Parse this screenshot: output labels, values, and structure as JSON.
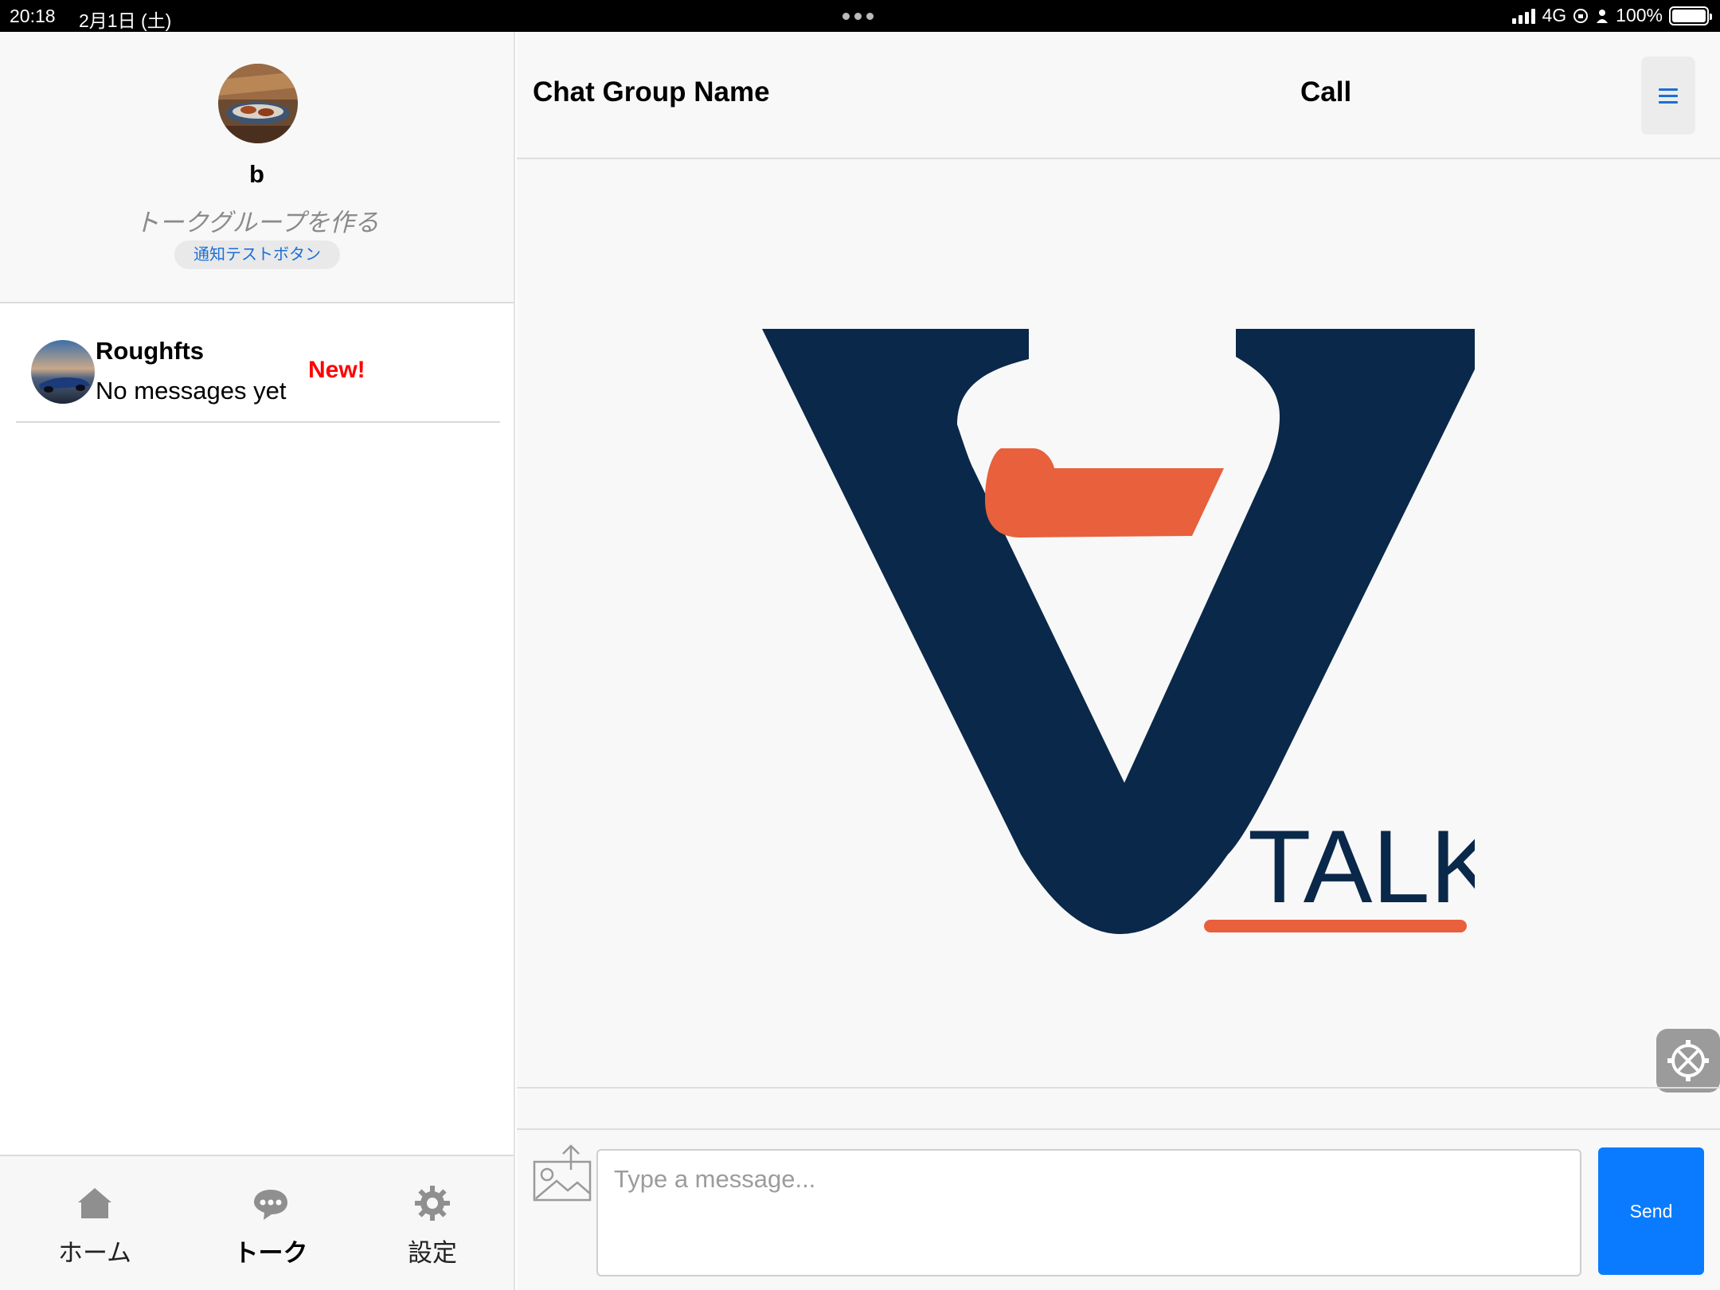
{
  "status_bar": {
    "time": "20:18",
    "date": "2月1日 (土)",
    "network": "4G",
    "battery": "100%"
  },
  "sidebar": {
    "profile": {
      "username": "b",
      "create_group": "トークグループを作る",
      "notify_test_button": "通知テストボタン"
    },
    "chats": [
      {
        "name": "Roughfts",
        "last_message": "No messages yet",
        "badge": "New!"
      }
    ],
    "tabs": [
      {
        "label": "ホーム",
        "icon": "home-icon",
        "active": false
      },
      {
        "label": "トーク",
        "icon": "chat-bubble-icon",
        "active": true
      },
      {
        "label": "設定",
        "icon": "gear-icon",
        "active": false
      }
    ]
  },
  "main": {
    "group_name": "Chat Group Name",
    "call_label": "Call",
    "menu_icon": "hamburger-menu-icon",
    "logo_text": "TALK",
    "composer": {
      "placeholder": "Type a message...",
      "send_label": "Send",
      "image_icon": "image-upload-icon"
    }
  },
  "colors": {
    "accent_blue": "#0a7bff",
    "logo_navy": "#0a2849",
    "logo_orange": "#e8603c",
    "new_badge": "#ff0000"
  }
}
